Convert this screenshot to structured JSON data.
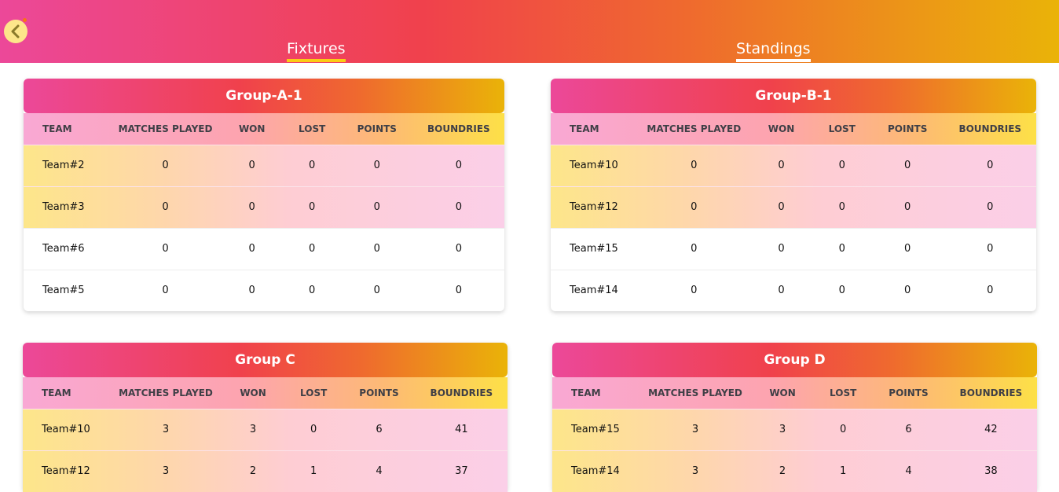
{
  "nav": {
    "back_icon": "chevron-left-icon",
    "tabs": [
      {
        "label": "Fixtures",
        "active": false
      },
      {
        "label": "Standings",
        "active": true
      }
    ]
  },
  "columns": [
    "TEAM",
    "MATCHES PLAYED",
    "WON",
    "LOST",
    "POINTS",
    "BOUNDRIES"
  ],
  "groups": [
    {
      "title": "Group-A-1",
      "rows": [
        {
          "team": "Team#2",
          "played": "0",
          "won": "0",
          "lost": "0",
          "points": "0",
          "boundries": "0",
          "highlighted": true
        },
        {
          "team": "Team#3",
          "played": "0",
          "won": "0",
          "lost": "0",
          "points": "0",
          "boundries": "0",
          "highlighted": true
        },
        {
          "team": "Team#6",
          "played": "0",
          "won": "0",
          "lost": "0",
          "points": "0",
          "boundries": "0",
          "highlighted": false
        },
        {
          "team": "Team#5",
          "played": "0",
          "won": "0",
          "lost": "0",
          "points": "0",
          "boundries": "0",
          "highlighted": false
        }
      ]
    },
    {
      "title": "Group-B-1",
      "rows": [
        {
          "team": "Team#10",
          "played": "0",
          "won": "0",
          "lost": "0",
          "points": "0",
          "boundries": "0",
          "highlighted": true
        },
        {
          "team": "Team#12",
          "played": "0",
          "won": "0",
          "lost": "0",
          "points": "0",
          "boundries": "0",
          "highlighted": true
        },
        {
          "team": "Team#15",
          "played": "0",
          "won": "0",
          "lost": "0",
          "points": "0",
          "boundries": "0",
          "highlighted": false
        },
        {
          "team": "Team#14",
          "played": "0",
          "won": "0",
          "lost": "0",
          "points": "0",
          "boundries": "0",
          "highlighted": false
        }
      ]
    },
    {
      "title": "Group C",
      "rows": [
        {
          "team": "Team#10",
          "played": "3",
          "won": "3",
          "lost": "0",
          "points": "6",
          "boundries": "41",
          "highlighted": true
        },
        {
          "team": "Team#12",
          "played": "3",
          "won": "2",
          "lost": "1",
          "points": "4",
          "boundries": "37",
          "highlighted": true
        }
      ]
    },
    {
      "title": "Group D",
      "rows": [
        {
          "team": "Team#15",
          "played": "3",
          "won": "3",
          "lost": "0",
          "points": "6",
          "boundries": "42",
          "highlighted": true
        },
        {
          "team": "Team#14",
          "played": "3",
          "won": "2",
          "lost": "1",
          "points": "4",
          "boundries": "38",
          "highlighted": true
        }
      ]
    }
  ]
}
